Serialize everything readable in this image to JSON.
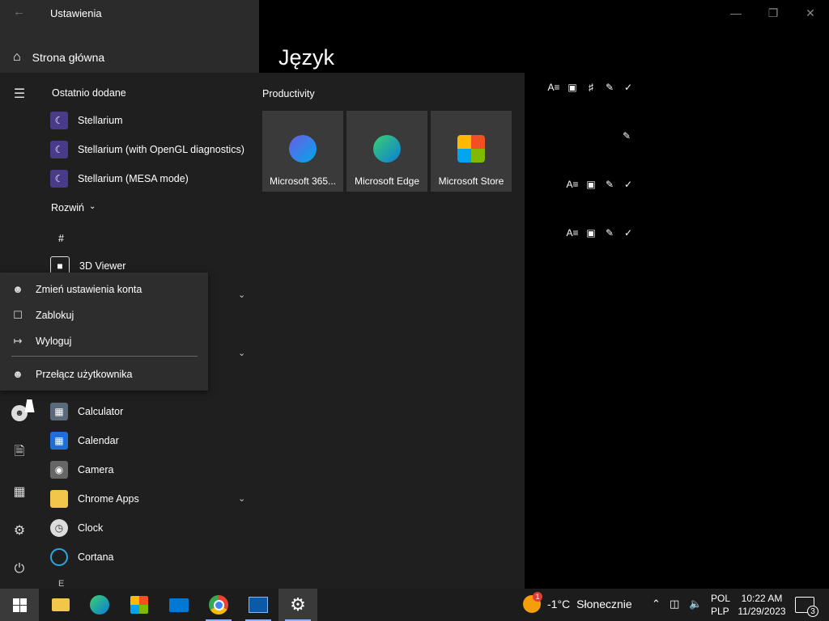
{
  "settings": {
    "title": "Ustawienia",
    "home_label": "Strona główna",
    "page_title": "Język"
  },
  "start_menu": {
    "recently_added_label": "Ostatnio dodane",
    "recent_apps": [
      "Stellarium",
      "Stellarium (with OpenGL diagnostics)",
      "Stellarium (MESA mode)"
    ],
    "expand_label": "Rozwiń",
    "hash_label": "#",
    "apps": {
      "viewer3d": "3D Viewer",
      "calculator": "Calculator",
      "calendar": "Calendar",
      "camera": "Camera",
      "chrome_apps": "Chrome Apps",
      "clock": "Clock",
      "cortana": "Cortana",
      "e_letter": "E"
    },
    "tiles_group": "Productivity",
    "tiles": [
      "Microsoft 365...",
      "Microsoft Edge",
      "Microsoft Store"
    ]
  },
  "account_flyout": {
    "change_settings": "Zmień ustawienia konta",
    "lock": "Zablokuj",
    "sign_out": "Wyloguj",
    "switch_user": "Przełącz użytkownika"
  },
  "taskbar": {
    "weather_temp": "-1°C",
    "weather_desc": "Słonecznie",
    "weather_badge": "1",
    "lang_code": "POL",
    "lang_layout": "PLP",
    "time": "10:22 AM",
    "date": "11/29/2023",
    "notification_count": "3"
  },
  "colors": {
    "accent": "#0078d4",
    "start_bg": "#1f1f1f",
    "tile_bg": "#3a3a3a"
  }
}
